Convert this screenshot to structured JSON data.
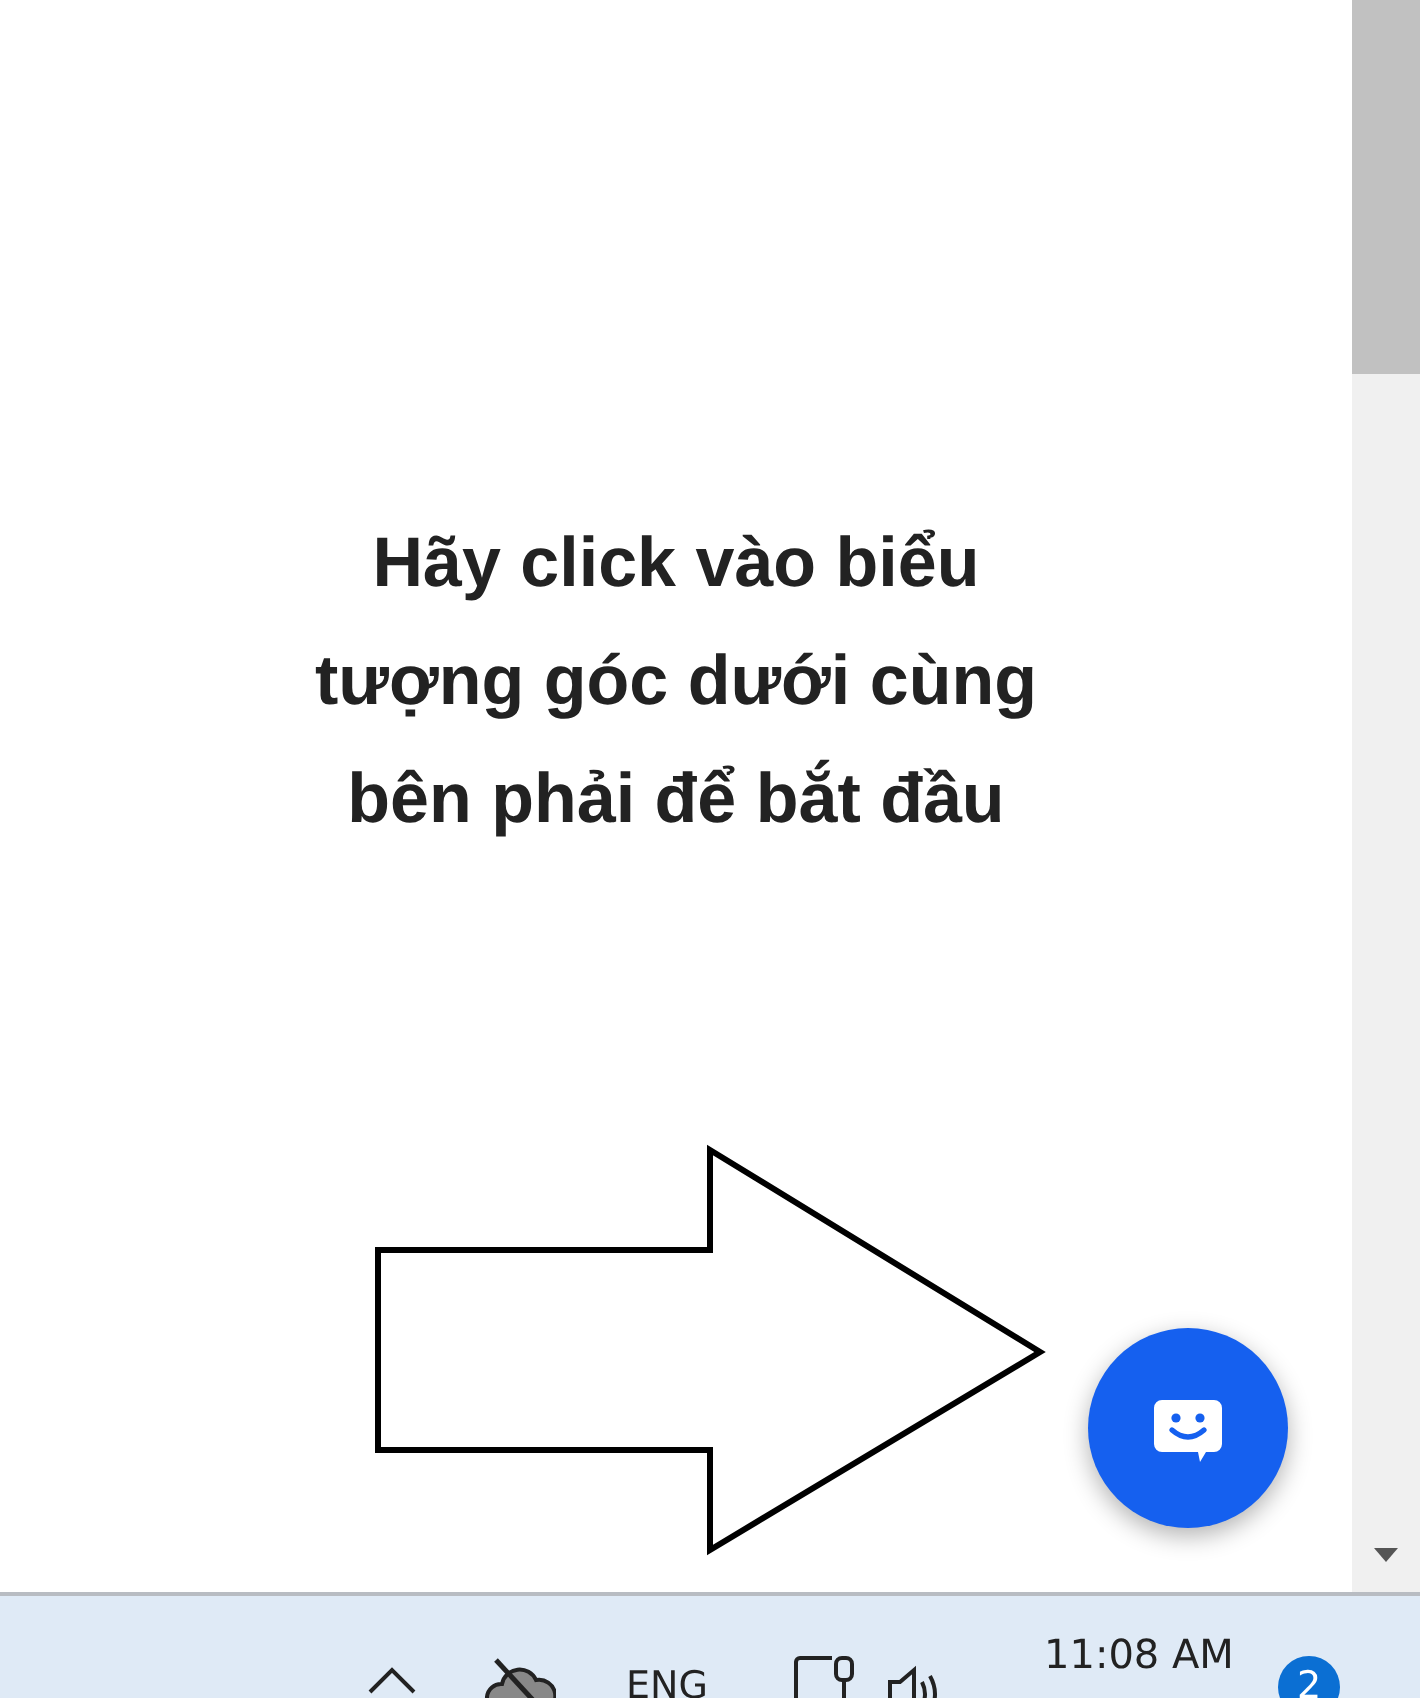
{
  "message": {
    "lines": [
      "Hãy click vào biểu",
      "tượng góc dưới cùng",
      "bên phải để bắt đầu"
    ]
  },
  "taskbar": {
    "language": "ENG",
    "time": "11:08 AM",
    "notification_count": "2"
  }
}
